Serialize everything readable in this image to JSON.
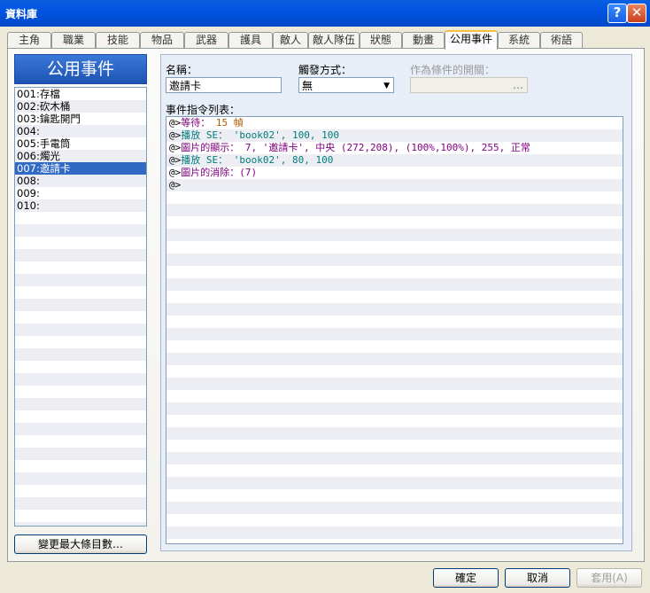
{
  "window": {
    "title": "資料庫",
    "help_glyph": "?",
    "close_glyph": "✕"
  },
  "tabs": [
    "主角",
    "職業",
    "技能",
    "物品",
    "武器",
    "護具",
    "敵人",
    "敵人隊伍",
    "狀態",
    "動畫",
    "公用事件",
    "系統",
    "術語"
  ],
  "active_tab_index": 10,
  "left": {
    "header": "公用事件",
    "items": [
      "001:存檔",
      "002:砍木桶",
      "003:鑰匙開門",
      "004:",
      "005:手電筒",
      "006:燭光",
      "007:邀請卡",
      "008:",
      "009:",
      "010:"
    ],
    "selected_index": 6,
    "change_max_button": "變更最大條目數…"
  },
  "form": {
    "name_label": "名稱：",
    "name_value": "邀請卡",
    "trigger_label": "觸發方式：",
    "trigger_value": "無",
    "switch_label": "作為條件的開關：",
    "switch_button": "…",
    "list_label": "事件指令列表："
  },
  "commands": [
    {
      "prefix": "@>",
      "text": "等待：",
      "args": " 15 幀",
      "color": "purple",
      "args_color": "orange"
    },
    {
      "prefix": "@>",
      "text": "播放 SE：",
      "args": " 'book02', 100, 100",
      "color": "teal",
      "args_color": "teal"
    },
    {
      "prefix": "@>",
      "text": "圖片的顯示：",
      "args": " 7, '邀請卡', 中央 (272,208), (100%,100%), 255, 正常",
      "color": "purple",
      "args_color": "purple"
    },
    {
      "prefix": "@>",
      "text": "播放 SE：",
      "args": " 'book02', 80, 100",
      "color": "teal",
      "args_color": "teal"
    },
    {
      "prefix": "@>",
      "text": "圖片的消除：",
      "args": "(7)",
      "color": "purple",
      "args_color": "purple"
    },
    {
      "prefix": "@>",
      "text": "",
      "args": "",
      "color": "black",
      "args_color": "black"
    }
  ],
  "buttons": {
    "ok": "確定",
    "cancel": "取消",
    "apply": "套用(A)"
  }
}
